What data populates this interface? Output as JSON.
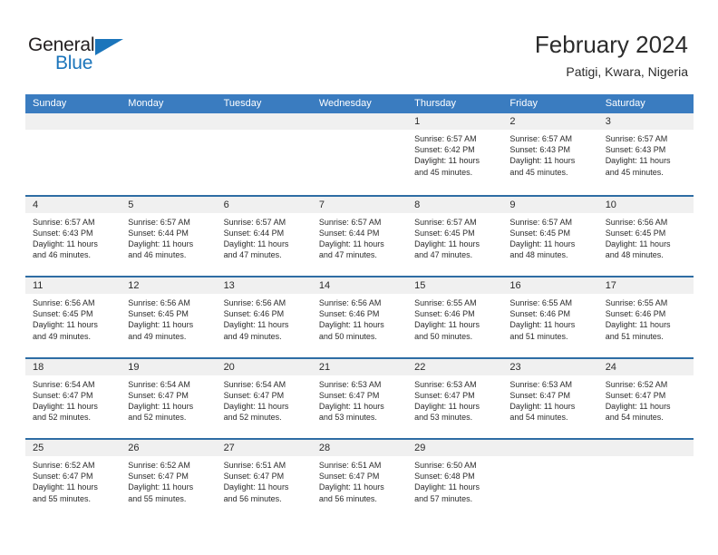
{
  "brand": {
    "name_part1": "General",
    "name_part2": "Blue"
  },
  "header": {
    "title": "February 2024",
    "subtitle": "Patigi, Kwara, Nigeria"
  },
  "colors": {
    "header_blue": "#3a7cc0",
    "row_separator_blue": "#2e6da4",
    "daynum_background": "#f0f0f0",
    "brand_blue": "#1b75bb",
    "text": "#2b2b2b"
  },
  "weekdays": [
    "Sunday",
    "Monday",
    "Tuesday",
    "Wednesday",
    "Thursday",
    "Friday",
    "Saturday"
  ],
  "weeks": [
    [
      {
        "day": "",
        "empty": true
      },
      {
        "day": "",
        "empty": true
      },
      {
        "day": "",
        "empty": true
      },
      {
        "day": "",
        "empty": true
      },
      {
        "day": "1",
        "sunrise": "Sunrise: 6:57 AM",
        "sunset": "Sunset: 6:42 PM",
        "daylight1": "Daylight: 11 hours",
        "daylight2": "and 45 minutes."
      },
      {
        "day": "2",
        "sunrise": "Sunrise: 6:57 AM",
        "sunset": "Sunset: 6:43 PM",
        "daylight1": "Daylight: 11 hours",
        "daylight2": "and 45 minutes."
      },
      {
        "day": "3",
        "sunrise": "Sunrise: 6:57 AM",
        "sunset": "Sunset: 6:43 PM",
        "daylight1": "Daylight: 11 hours",
        "daylight2": "and 45 minutes."
      }
    ],
    [
      {
        "day": "4",
        "sunrise": "Sunrise: 6:57 AM",
        "sunset": "Sunset: 6:43 PM",
        "daylight1": "Daylight: 11 hours",
        "daylight2": "and 46 minutes."
      },
      {
        "day": "5",
        "sunrise": "Sunrise: 6:57 AM",
        "sunset": "Sunset: 6:44 PM",
        "daylight1": "Daylight: 11 hours",
        "daylight2": "and 46 minutes."
      },
      {
        "day": "6",
        "sunrise": "Sunrise: 6:57 AM",
        "sunset": "Sunset: 6:44 PM",
        "daylight1": "Daylight: 11 hours",
        "daylight2": "and 47 minutes."
      },
      {
        "day": "7",
        "sunrise": "Sunrise: 6:57 AM",
        "sunset": "Sunset: 6:44 PM",
        "daylight1": "Daylight: 11 hours",
        "daylight2": "and 47 minutes."
      },
      {
        "day": "8",
        "sunrise": "Sunrise: 6:57 AM",
        "sunset": "Sunset: 6:45 PM",
        "daylight1": "Daylight: 11 hours",
        "daylight2": "and 47 minutes."
      },
      {
        "day": "9",
        "sunrise": "Sunrise: 6:57 AM",
        "sunset": "Sunset: 6:45 PM",
        "daylight1": "Daylight: 11 hours",
        "daylight2": "and 48 minutes."
      },
      {
        "day": "10",
        "sunrise": "Sunrise: 6:56 AM",
        "sunset": "Sunset: 6:45 PM",
        "daylight1": "Daylight: 11 hours",
        "daylight2": "and 48 minutes."
      }
    ],
    [
      {
        "day": "11",
        "sunrise": "Sunrise: 6:56 AM",
        "sunset": "Sunset: 6:45 PM",
        "daylight1": "Daylight: 11 hours",
        "daylight2": "and 49 minutes."
      },
      {
        "day": "12",
        "sunrise": "Sunrise: 6:56 AM",
        "sunset": "Sunset: 6:45 PM",
        "daylight1": "Daylight: 11 hours",
        "daylight2": "and 49 minutes."
      },
      {
        "day": "13",
        "sunrise": "Sunrise: 6:56 AM",
        "sunset": "Sunset: 6:46 PM",
        "daylight1": "Daylight: 11 hours",
        "daylight2": "and 49 minutes."
      },
      {
        "day": "14",
        "sunrise": "Sunrise: 6:56 AM",
        "sunset": "Sunset: 6:46 PM",
        "daylight1": "Daylight: 11 hours",
        "daylight2": "and 50 minutes."
      },
      {
        "day": "15",
        "sunrise": "Sunrise: 6:55 AM",
        "sunset": "Sunset: 6:46 PM",
        "daylight1": "Daylight: 11 hours",
        "daylight2": "and 50 minutes."
      },
      {
        "day": "16",
        "sunrise": "Sunrise: 6:55 AM",
        "sunset": "Sunset: 6:46 PM",
        "daylight1": "Daylight: 11 hours",
        "daylight2": "and 51 minutes."
      },
      {
        "day": "17",
        "sunrise": "Sunrise: 6:55 AM",
        "sunset": "Sunset: 6:46 PM",
        "daylight1": "Daylight: 11 hours",
        "daylight2": "and 51 minutes."
      }
    ],
    [
      {
        "day": "18",
        "sunrise": "Sunrise: 6:54 AM",
        "sunset": "Sunset: 6:47 PM",
        "daylight1": "Daylight: 11 hours",
        "daylight2": "and 52 minutes."
      },
      {
        "day": "19",
        "sunrise": "Sunrise: 6:54 AM",
        "sunset": "Sunset: 6:47 PM",
        "daylight1": "Daylight: 11 hours",
        "daylight2": "and 52 minutes."
      },
      {
        "day": "20",
        "sunrise": "Sunrise: 6:54 AM",
        "sunset": "Sunset: 6:47 PM",
        "daylight1": "Daylight: 11 hours",
        "daylight2": "and 52 minutes."
      },
      {
        "day": "21",
        "sunrise": "Sunrise: 6:53 AM",
        "sunset": "Sunset: 6:47 PM",
        "daylight1": "Daylight: 11 hours",
        "daylight2": "and 53 minutes."
      },
      {
        "day": "22",
        "sunrise": "Sunrise: 6:53 AM",
        "sunset": "Sunset: 6:47 PM",
        "daylight1": "Daylight: 11 hours",
        "daylight2": "and 53 minutes."
      },
      {
        "day": "23",
        "sunrise": "Sunrise: 6:53 AM",
        "sunset": "Sunset: 6:47 PM",
        "daylight1": "Daylight: 11 hours",
        "daylight2": "and 54 minutes."
      },
      {
        "day": "24",
        "sunrise": "Sunrise: 6:52 AM",
        "sunset": "Sunset: 6:47 PM",
        "daylight1": "Daylight: 11 hours",
        "daylight2": "and 54 minutes."
      }
    ],
    [
      {
        "day": "25",
        "sunrise": "Sunrise: 6:52 AM",
        "sunset": "Sunset: 6:47 PM",
        "daylight1": "Daylight: 11 hours",
        "daylight2": "and 55 minutes."
      },
      {
        "day": "26",
        "sunrise": "Sunrise: 6:52 AM",
        "sunset": "Sunset: 6:47 PM",
        "daylight1": "Daylight: 11 hours",
        "daylight2": "and 55 minutes."
      },
      {
        "day": "27",
        "sunrise": "Sunrise: 6:51 AM",
        "sunset": "Sunset: 6:47 PM",
        "daylight1": "Daylight: 11 hours",
        "daylight2": "and 56 minutes."
      },
      {
        "day": "28",
        "sunrise": "Sunrise: 6:51 AM",
        "sunset": "Sunset: 6:47 PM",
        "daylight1": "Daylight: 11 hours",
        "daylight2": "and 56 minutes."
      },
      {
        "day": "29",
        "sunrise": "Sunrise: 6:50 AM",
        "sunset": "Sunset: 6:48 PM",
        "daylight1": "Daylight: 11 hours",
        "daylight2": "and 57 minutes."
      },
      {
        "day": "",
        "empty": true
      },
      {
        "day": "",
        "empty": true
      }
    ]
  ]
}
